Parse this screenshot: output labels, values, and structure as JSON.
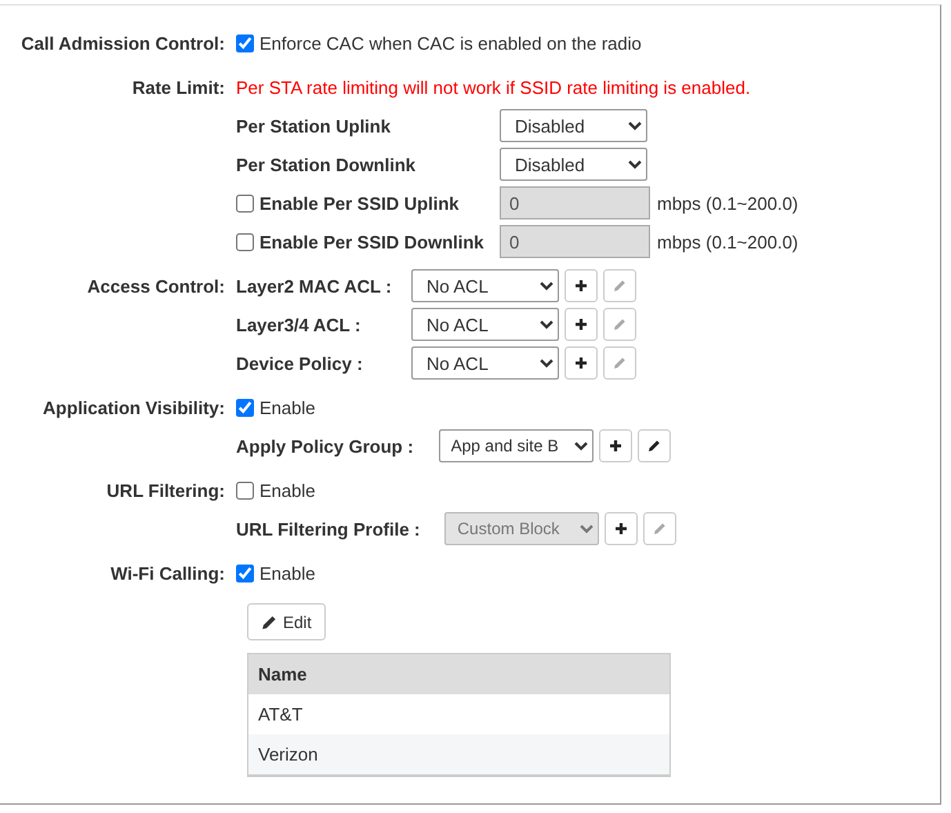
{
  "rows": [
    {
      "kind": "checkbox",
      "label": "Call Admission Control:",
      "checked": true,
      "text": "Enforce CAC when CAC is enabled on the radio"
    },
    {
      "kind": "note",
      "label": "Rate Limit:",
      "text": "Per STA rate limiting will not work if SSID rate limiting is enabled."
    },
    {
      "kind": "rate-select",
      "sublabel": "Per Station Uplink",
      "value": "Disabled"
    },
    {
      "kind": "rate-select",
      "sublabel": "Per Station Downlink",
      "value": "Disabled"
    },
    {
      "kind": "rate-input",
      "checked": false,
      "sublabel": "Enable Per SSID Uplink",
      "value": "0",
      "disabled": true,
      "unit": "mbps (0.1~200.0)"
    },
    {
      "kind": "rate-input",
      "checked": false,
      "sublabel": "Enable Per SSID Downlink",
      "value": "0",
      "disabled": true,
      "unit": "mbps (0.1~200.0)"
    },
    {
      "kind": "acl",
      "label": "Access Control:",
      "sublabel": "Layer2 MAC ACL :",
      "value": "No ACL",
      "disabled": false,
      "edit_disabled": true
    },
    {
      "kind": "acl",
      "sublabel": "Layer3/4 ACL :",
      "value": "No ACL",
      "disabled": false,
      "edit_disabled": true
    },
    {
      "kind": "acl",
      "sublabel": "Device Policy :",
      "value": "No ACL",
      "disabled": false,
      "edit_disabled": true
    },
    {
      "kind": "checkbox",
      "label": "Application Visibility:",
      "checked": true,
      "text": "Enable"
    },
    {
      "kind": "policy",
      "sublabel": "Apply Policy Group :",
      "value": "App and site B",
      "disabled": false,
      "edit_disabled": false
    },
    {
      "kind": "checkbox",
      "label": "URL Filtering:",
      "checked": false,
      "text": "Enable"
    },
    {
      "kind": "policy",
      "sublabel": "URL Filtering Profile :",
      "value": "Custom Block",
      "disabled": true,
      "edit_disabled": true
    },
    {
      "kind": "checkbox",
      "label": "Wi-Fi Calling:",
      "checked": true,
      "text": "Enable"
    }
  ],
  "edit_button": "Edit",
  "table": {
    "columns": [
      "Name"
    ],
    "rows": [
      [
        "AT&T"
      ],
      [
        "Verizon"
      ]
    ]
  }
}
